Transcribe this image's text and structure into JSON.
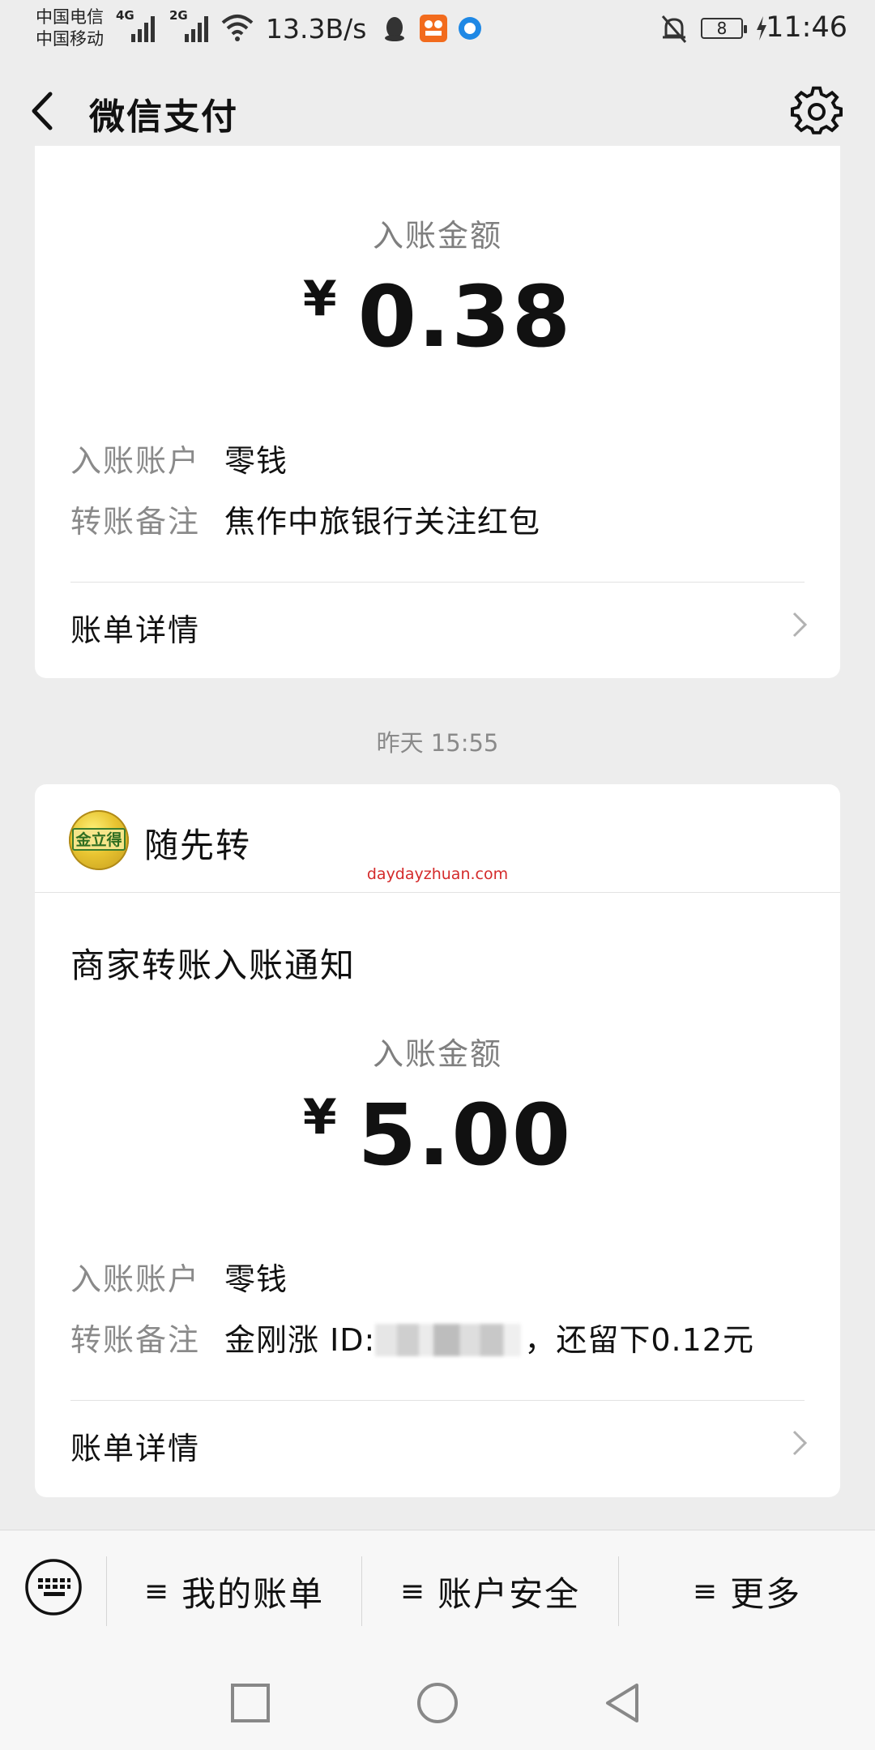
{
  "status_bar": {
    "carrier_1": "中国电信",
    "carrier_2": "中国移动",
    "network_1": "4G",
    "network_2": "2G",
    "net_speed": "13.3B/s",
    "battery_level": "8",
    "time": "11:46"
  },
  "header": {
    "title": "微信支付"
  },
  "card1": {
    "amount_label": "入账金额",
    "currency": "¥",
    "amount": "0.38",
    "account_key": "入账账户",
    "account_value": "零钱",
    "note_key": "转账备注",
    "note_value": "焦作中旅银行关注红包",
    "detail_label": "账单详情"
  },
  "timestamp": "昨天 15:55",
  "card2": {
    "merchant_logo_text": "金立得",
    "merchant_name": "随先转",
    "watermark": "daydayzhuan.com",
    "notice_title": "商家转账入账通知",
    "amount_label": "入账金额",
    "currency": "¥",
    "amount": "5.00",
    "account_key": "入账账户",
    "account_value": "零钱",
    "note_key": "转账备注",
    "note_prefix": "金刚涨 ID:",
    "note_suffix": "，还留下0.12元",
    "detail_label": "账单详情"
  },
  "bottom_menu": {
    "items": [
      {
        "label": "我的账单"
      },
      {
        "label": "账户安全"
      },
      {
        "label": "更多"
      }
    ]
  }
}
